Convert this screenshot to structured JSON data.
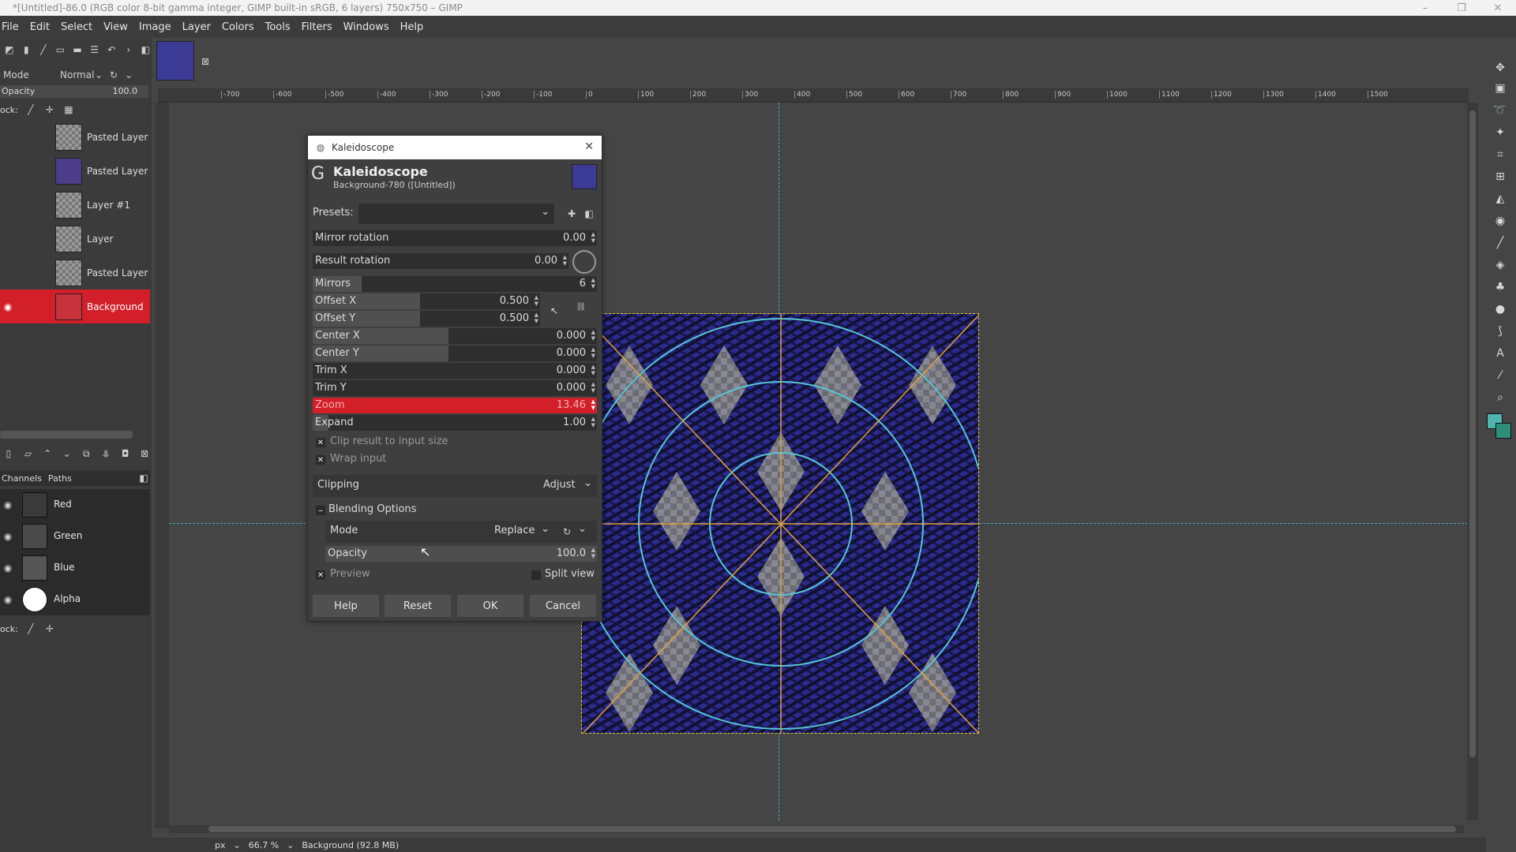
{
  "window": {
    "title": "*[Untitled]-86.0 (RGB color 8-bit gamma integer, GIMP built-in sRGB, 6 layers) 750x750 – GIMP"
  },
  "menu": [
    "File",
    "Edit",
    "Select",
    "View",
    "Image",
    "Layer",
    "Colors",
    "Tools",
    "Filters",
    "Windows",
    "Help"
  ],
  "tool_options": {
    "mode_label": "Mode",
    "mode_value": "Normal",
    "opacity_label": "Opacity",
    "opacity_value": "100.0",
    "lock_label": "ock:"
  },
  "layers": [
    {
      "name": "Pasted Layer"
    },
    {
      "name": "Pasted Layer"
    },
    {
      "name": "Layer #1"
    },
    {
      "name": "Layer"
    },
    {
      "name": "Pasted Layer"
    },
    {
      "name": "Background",
      "selected": true
    }
  ],
  "channels_tabs": {
    "channels": "Channels",
    "paths": "Paths"
  },
  "channels": [
    {
      "name": "Red"
    },
    {
      "name": "Green"
    },
    {
      "name": "Blue"
    },
    {
      "name": "Alpha"
    }
  ],
  "channels_lock_label": "ock:",
  "ruler_ticks": [
    "-700",
    "-600",
    "-500",
    "-400",
    "-300",
    "-200",
    "-100",
    "0",
    "100",
    "200",
    "300",
    "400",
    "500",
    "600",
    "700",
    "800",
    "900",
    "1000",
    "1100",
    "1200",
    "1300",
    "1400",
    "1500"
  ],
  "status": {
    "unit": "px",
    "zoom": "66.7 %",
    "info": "Background (92.8 MB)"
  },
  "dialog": {
    "window_title": "Kaleidoscope",
    "heading": "Kaleidoscope",
    "subheading": "Background-780 ([Untitled])",
    "presets_label": "Presets:",
    "presets_value": "",
    "fields": {
      "mirror_rotation": {
        "label": "Mirror rotation",
        "value": "0.00"
      },
      "result_rotation": {
        "label": "Result rotation",
        "value": "0.00"
      },
      "mirrors": {
        "label": "Mirrors",
        "value": "6"
      },
      "offset_x": {
        "label": "Offset X",
        "value": "0.500"
      },
      "offset_y": {
        "label": "Offset Y",
        "value": "0.500"
      },
      "center_x": {
        "label": "Center X",
        "value": "0.000"
      },
      "center_y": {
        "label": "Center Y",
        "value": "0.000"
      },
      "trim_x": {
        "label": "Trim X",
        "value": "0.000"
      },
      "trim_y": {
        "label": "Trim Y",
        "value": "0.000"
      },
      "zoom": {
        "label": "Zoom",
        "value": "13.46"
      },
      "expand": {
        "label": "Expand",
        "value": "1.00"
      }
    },
    "clip_result": "Clip result to input size",
    "wrap_input": "Wrap input",
    "clipping_label": "Clipping",
    "clipping_value": "Adjust",
    "blending_options": "Blending Options",
    "blend_mode_label": "Mode",
    "blend_mode_value": "Replace",
    "blend_opacity_label": "Opacity",
    "blend_opacity_value": "100.0",
    "preview_label": "Preview",
    "split_view_label": "Split view",
    "buttons": {
      "help": "Help",
      "reset": "Reset",
      "ok": "OK",
      "cancel": "Cancel"
    }
  },
  "colors": {
    "accent_red": "#d21f2a",
    "fg_swatch": "#4fb3b0",
    "bg_swatch": "#2d8f7a"
  }
}
